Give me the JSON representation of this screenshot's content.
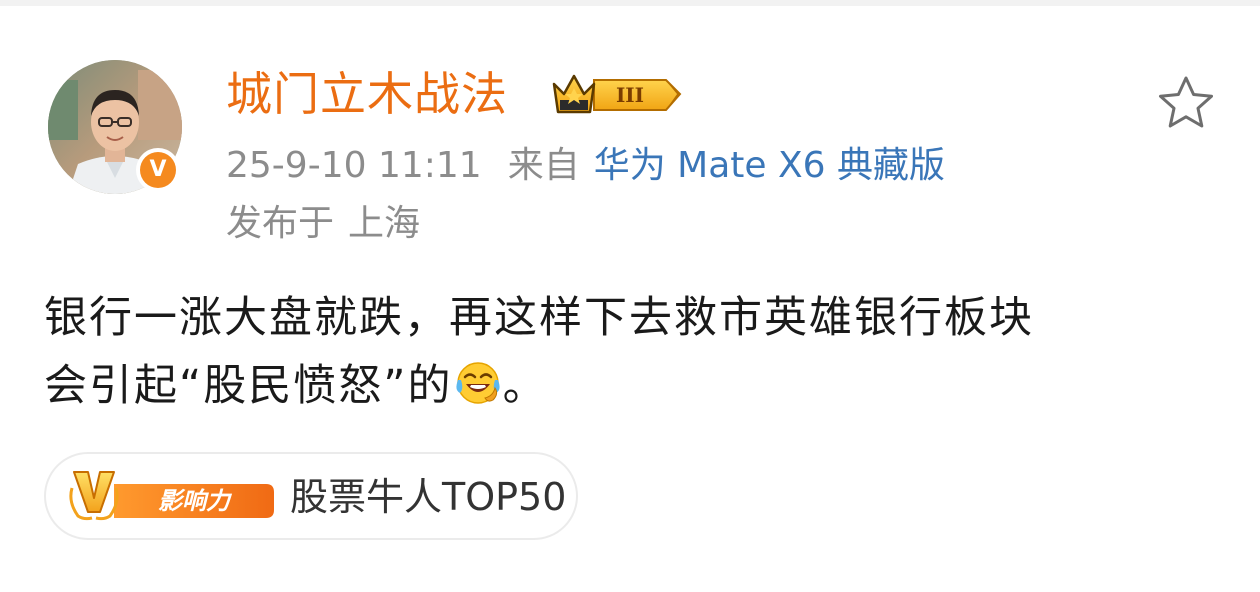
{
  "post": {
    "author": {
      "name": "城门立木战法",
      "verified_mark": "V",
      "rank_numeral": "III"
    },
    "timestamp": "25-9-10 11:11",
    "source_prefix": "来自",
    "source_device": "华为 Mate X6 典藏版",
    "location_prefix": "发布于",
    "location": "上海",
    "text_line1": "银行一涨大盘就跌，再这样下去救市英雄银行板块",
    "text_line2_before": "会引起“股民愤怒”的",
    "text_line2_after": "。",
    "emoji": "laughing-crying-emoji",
    "tag": {
      "badge_letter": "V",
      "badge_label": "影响力",
      "label": "股票牛人TOP50"
    }
  },
  "colors": {
    "author_name": "#eb6d12",
    "meta_gray": "#8c8c8c",
    "device_link": "#3a76b8",
    "verified_orange": "#f58a1f",
    "badge_orange": "#f47a1a"
  }
}
